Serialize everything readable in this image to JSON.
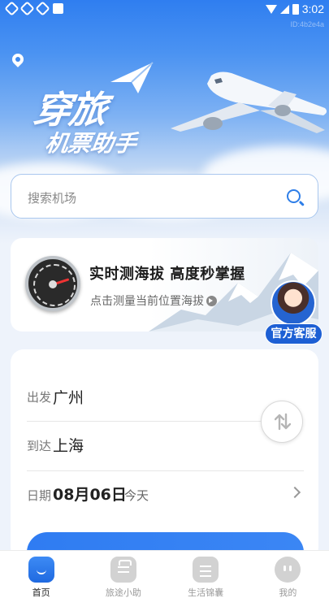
{
  "status_bar": {
    "time": "3:02"
  },
  "device_id": "ID:4b2e4a",
  "header": {
    "logo_line1": "穿旅",
    "logo_line2": "机票助手"
  },
  "search": {
    "placeholder": "搜索机场"
  },
  "altitude_banner": {
    "title": "实时测海拔 高度秒掌握",
    "subtitle": "点击测量当前位置海拔",
    "customer_service_label": "官方客服"
  },
  "booking": {
    "depart_label": "出发",
    "depart_city": "广州",
    "arrive_label": "到达",
    "arrive_city": "上海",
    "date_label": "日期",
    "date_value": "08月06日",
    "date_note": "今天"
  },
  "bottom_nav": {
    "items": [
      {
        "label": "首页",
        "icon": "home-icon",
        "active": true
      },
      {
        "label": "旅途小助",
        "icon": "suitcase-icon",
        "active": false
      },
      {
        "label": "生活锦囊",
        "icon": "notes-icon",
        "active": false
      },
      {
        "label": "我的",
        "icon": "profile-icon",
        "active": false
      }
    ]
  },
  "colors": {
    "accent": "#2f7cf2",
    "cs_badge": "#1d5fd4"
  }
}
